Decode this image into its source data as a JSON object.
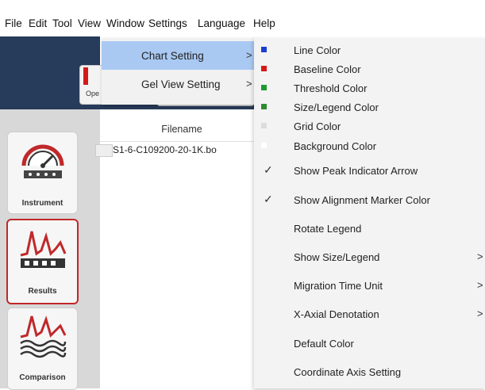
{
  "menubar": {
    "items": [
      "File",
      "Edit",
      "Tool",
      "View",
      "Window",
      "Settings",
      "Language",
      "Help"
    ]
  },
  "toolbar": {
    "open_label": "Ope"
  },
  "sidebar": {
    "buttons": [
      {
        "label": "Instrument"
      },
      {
        "label": "Results"
      },
      {
        "label": "Comparison"
      }
    ]
  },
  "table": {
    "header": "Filename",
    "rows": [
      "S1-6-C109200-20-1K.bo"
    ]
  },
  "view_menu": {
    "items": [
      {
        "label": "Chart Setting",
        "arrow": ">"
      },
      {
        "label": "Gel View Setting",
        "arrow": ">"
      }
    ]
  },
  "chart_setting_menu": {
    "colors": [
      {
        "label": "Line Color",
        "swatch": "#1a3fd0"
      },
      {
        "label": "Baseline Color",
        "swatch": "#d81818"
      },
      {
        "label": "Threshold Color",
        "swatch": "#1f9a2e"
      },
      {
        "label": "Size/Legend Color",
        "swatch": "#2f8a2f"
      },
      {
        "label": "Grid Color",
        "swatch": "#dcdcdc"
      },
      {
        "label": "Background Color",
        "swatch": "#ffffff"
      }
    ],
    "options": [
      {
        "label": "Show Peak Indicator Arrow",
        "checked": "✓",
        "sub": ""
      },
      {
        "label": "Show Alignment Marker Color",
        "checked": "✓",
        "sub": ""
      },
      {
        "label": "Rotate Legend",
        "checked": "",
        "sub": ""
      },
      {
        "label": "Show Size/Legend",
        "checked": "",
        "sub": ">"
      },
      {
        "label": "Migration Time Unit",
        "checked": "",
        "sub": ">"
      },
      {
        "label": "X-Axial Denotation",
        "checked": "",
        "sub": ">"
      },
      {
        "label": "Default Color",
        "checked": "",
        "sub": ""
      },
      {
        "label": "Coordinate Axis Setting",
        "checked": "",
        "sub": ""
      }
    ]
  }
}
